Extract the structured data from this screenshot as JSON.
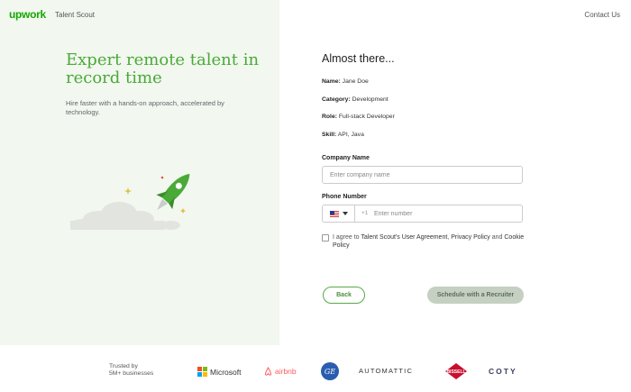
{
  "header": {
    "logo": "upwork",
    "product": "Talent Scout",
    "contact_label": "Contact Us"
  },
  "hero": {
    "headline": "Expert remote talent in record time",
    "tagline": "Hire faster with a hands-on approach, accelerated by technology."
  },
  "form": {
    "title": "Almost there...",
    "summary": [
      {
        "label": "Name:",
        "value": "Jane Doe"
      },
      {
        "label": "Category:",
        "value": "Development"
      },
      {
        "label": "Role:",
        "value": "Full-stack Developer"
      },
      {
        "label": "Skill:",
        "value": "API, Java"
      }
    ],
    "company": {
      "label": "Company Name",
      "placeholder": "Enter company name"
    },
    "phone": {
      "label": "Phone Number",
      "dial_code": "+1",
      "placeholder": "Enter number"
    },
    "consent": {
      "prefix": "I agree to",
      "agreement_link": "Talent Scout's User Agreement",
      "comma": ",",
      "privacy_link": "Privacy Policy",
      "and": "and",
      "cookie_link": "Cookie Policy"
    },
    "back_label": "Back",
    "schedule_label": "Schedule with a Recruiter"
  },
  "footer": {
    "trusted_line1": "Trusted by",
    "trusted_line2": "5M+ businesses",
    "brands": {
      "microsoft": "Microsoft",
      "airbnb": "airbnb",
      "ge": "GE",
      "automattic": "AUTOMATTIC",
      "bissell": "BISSELL",
      "coty": "COTY"
    }
  },
  "colors": {
    "brand_green": "#14a800",
    "headline_green": "#4aaa37",
    "panel_bg": "#f2f7f0",
    "disabled_button": "#c5cfc2"
  }
}
